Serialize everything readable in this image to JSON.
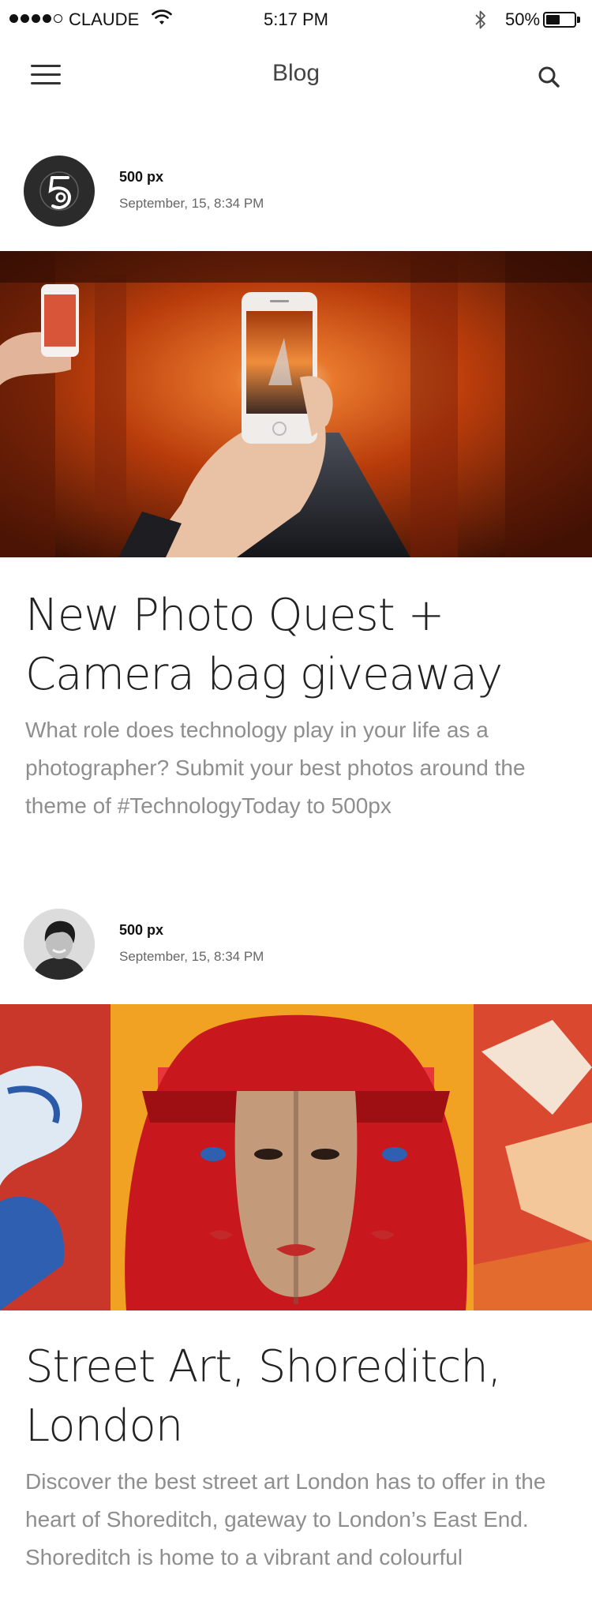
{
  "status_bar": {
    "carrier": "CLAUDE",
    "time": "5:17 PM",
    "battery": "50%",
    "battery_level": 0.5,
    "signal_bars_filled": 4,
    "signal_bars_total": 5,
    "icons": [
      "signal-icon",
      "wifi-icon",
      "bluetooth-icon",
      "battery-icon"
    ]
  },
  "nav": {
    "title": "Blog",
    "left_icon": "hamburger-menu-icon",
    "right_icon": "search-icon"
  },
  "posts": [
    {
      "author": "500 px",
      "date": "September, 15, 8:34 PM",
      "avatar_icon": "500px-logo-icon",
      "image": "phone-photo-torii-gates",
      "title": "New Photo Quest + Camera bag giveaway",
      "excerpt": "What role does technology play in your life as a photographer? Submit your best photos around the theme of #TechnologyToday to 500px"
    },
    {
      "author": "500 px",
      "date": "September, 15, 8:34 PM",
      "avatar_icon": "user-avatar",
      "image": "street-art-mural",
      "title": "Street Art, Shoreditch, London",
      "excerpt": "Discover the best street art London has to offer in the heart of Shoreditch, gateway to London’s East End. Shoreditch is home to a vibrant and colourful"
    }
  ],
  "colors": {
    "text": "#222222",
    "muted": "#8e8e8e",
    "divider": "#e6e6e6",
    "avatar_bg": "#2b2b2b"
  }
}
